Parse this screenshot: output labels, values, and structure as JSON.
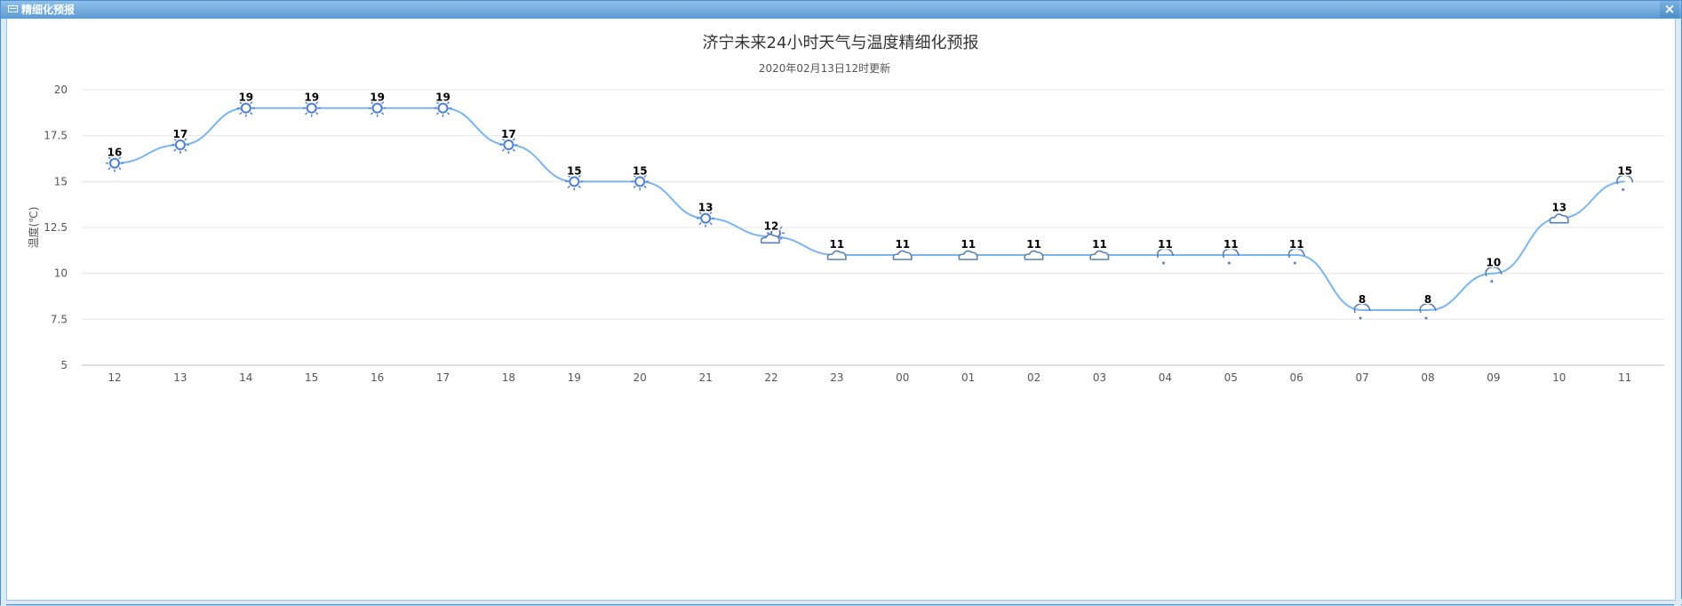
{
  "window": {
    "title": "精细化预报",
    "close_glyph": "×",
    "title_icon": "window-icon"
  },
  "colors": {
    "line": "#7cb5ec",
    "icon_sun": "#4f7fd0",
    "titlebar": "#5b9ad4"
  },
  "chart_data": {
    "type": "line",
    "title": "济宁未来24小时天气与温度精细化预报",
    "subtitle": "2020年02月13日12时更新",
    "ylabel": "温度(℃)",
    "xlabel": "",
    "ylim": [
      5,
      20
    ],
    "yticks": [
      "5",
      "7.5",
      "10",
      "12.5",
      "15",
      "17.5",
      "20"
    ],
    "grid": true,
    "categories": [
      "12",
      "13",
      "14",
      "15",
      "16",
      "17",
      "18",
      "19",
      "20",
      "21",
      "22",
      "23",
      "00",
      "01",
      "02",
      "03",
      "04",
      "05",
      "06",
      "07",
      "08",
      "09",
      "10",
      "11"
    ],
    "series": [
      {
        "values": [
          16,
          17,
          19,
          19,
          19,
          19,
          17,
          15,
          15,
          13,
          12,
          11,
          11,
          11,
          11,
          11,
          11,
          11,
          11,
          8,
          8,
          10,
          13,
          15
        ],
        "weather_icons": [
          "sun",
          "sun",
          "sun",
          "sun",
          "sun",
          "sun",
          "sun",
          "sun",
          "sun",
          "sun",
          "partly-cloudy",
          "cloudy",
          "cloudy",
          "cloudy",
          "cloudy",
          "cloudy",
          "light-rain",
          "light-rain",
          "light-rain",
          "light-rain",
          "light-rain",
          "light-rain",
          "cloudy",
          "light-rain"
        ]
      }
    ]
  }
}
